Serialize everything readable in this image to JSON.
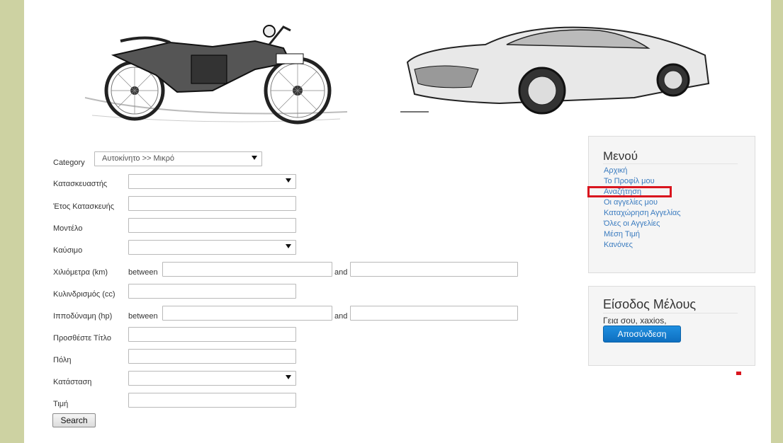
{
  "header": {
    "left_image_icon": "motorcycle-sketch",
    "right_image_icon": "car-sketch"
  },
  "search_form": {
    "category": {
      "label": "Category",
      "selected": "Αυτοκίνητο >> Μικρό"
    },
    "manufacturer": {
      "label": "Κατασκευαστής",
      "selected": ""
    },
    "year": {
      "label": "Έτος Κατασκευής",
      "value": ""
    },
    "model": {
      "label": "Μοντέλο",
      "value": ""
    },
    "fuel": {
      "label": "Καύσιμο",
      "selected": ""
    },
    "mileage": {
      "label": "Χιλιόμετρα (km)",
      "between": "between",
      "and": "and",
      "from": "",
      "to": ""
    },
    "displacement": {
      "label": "Κυλινδρισμός (cc)",
      "value": ""
    },
    "horsepower": {
      "label": "Ιπποδύναμη (hp)",
      "between": "between",
      "and": "and",
      "from": "",
      "to": ""
    },
    "title": {
      "label": "Προσθέστε Τίτλο",
      "value": ""
    },
    "city": {
      "label": "Πόλη",
      "value": ""
    },
    "condition": {
      "label": "Κατάσταση",
      "selected": ""
    },
    "price": {
      "label": "Τιμή",
      "value": ""
    },
    "search_label": "Search"
  },
  "menu": {
    "title": "Μενού",
    "items": [
      "Αρχική",
      "Το Προφίλ μου",
      "Αναζήτηση",
      "Οι αγγελίες μου",
      "Καταχώρηση Αγγελίας",
      "Όλες οι Αγγελίες",
      "Μέση Τιμή",
      "Κανόνες"
    ]
  },
  "login": {
    "title": "Είσοδος Μέλους",
    "greeting": "Γεια σου, xaxios,",
    "logout_label": "Αποσύνδεση"
  },
  "colors": {
    "side_bar": "#cdd2a2",
    "link": "#3a7bbf",
    "highlight": "#d9151e",
    "logout_button": "#1277c8"
  }
}
